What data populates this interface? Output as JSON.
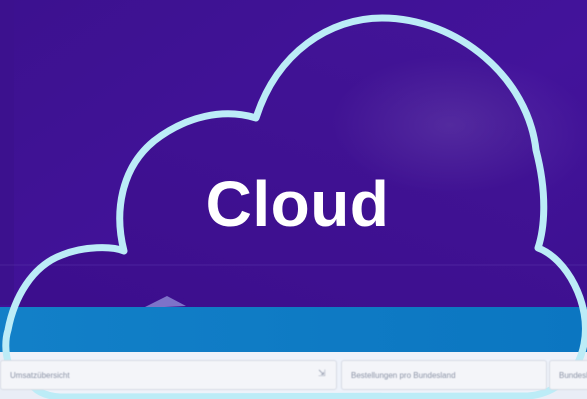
{
  "cloud": {
    "label": "Cloud",
    "outline_color": "#b9ecf6",
    "fill_color": "#3e0d8f"
  },
  "background": {
    "top_color": "#3c118e",
    "band_color": "#0b7ec8",
    "panel_color": "#ecf0f8"
  },
  "dashboard": {
    "left_title": "Umsatzübersicht",
    "right_title": "Bestellungen pro Bundesland",
    "far_title": "Bundesla",
    "export_icon": "export-icon"
  }
}
